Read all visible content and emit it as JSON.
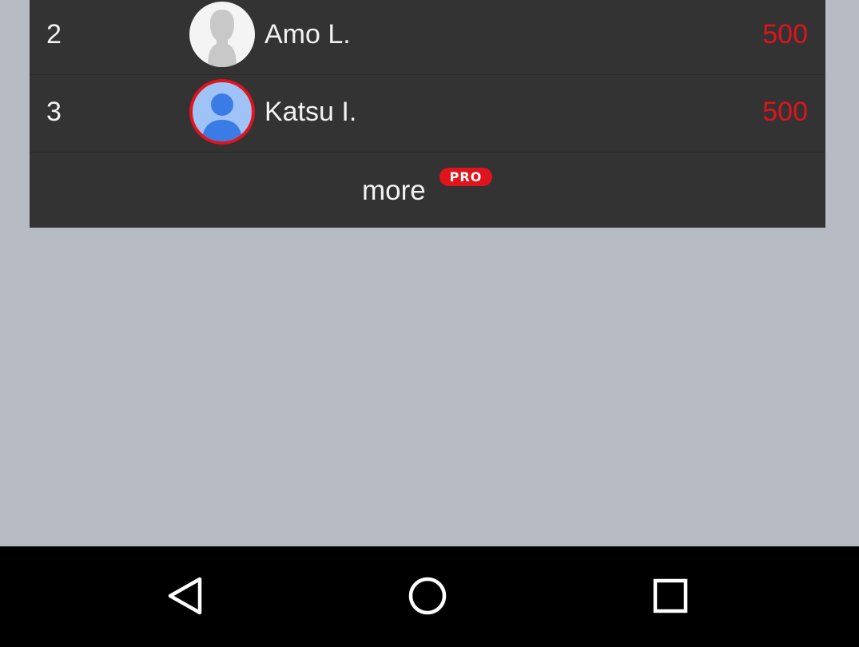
{
  "leaderboard": {
    "rows": [
      {
        "rank": "2",
        "name": "Amo L.",
        "score": "500",
        "avatar": "default-avatar-icon"
      },
      {
        "rank": "3",
        "name": "Katsu I.",
        "score": "500",
        "avatar": "user-avatar-icon"
      }
    ],
    "more_label": "more",
    "pro_badge": "PRO"
  },
  "colors": {
    "background": "#b7bcc4",
    "card": "#333333",
    "accent_red": "#e0141c",
    "text": "#f2f2f2",
    "nav_bar": "#000000"
  },
  "nav_bar": {
    "buttons": [
      "back-icon",
      "home-icon",
      "recents-icon"
    ]
  }
}
